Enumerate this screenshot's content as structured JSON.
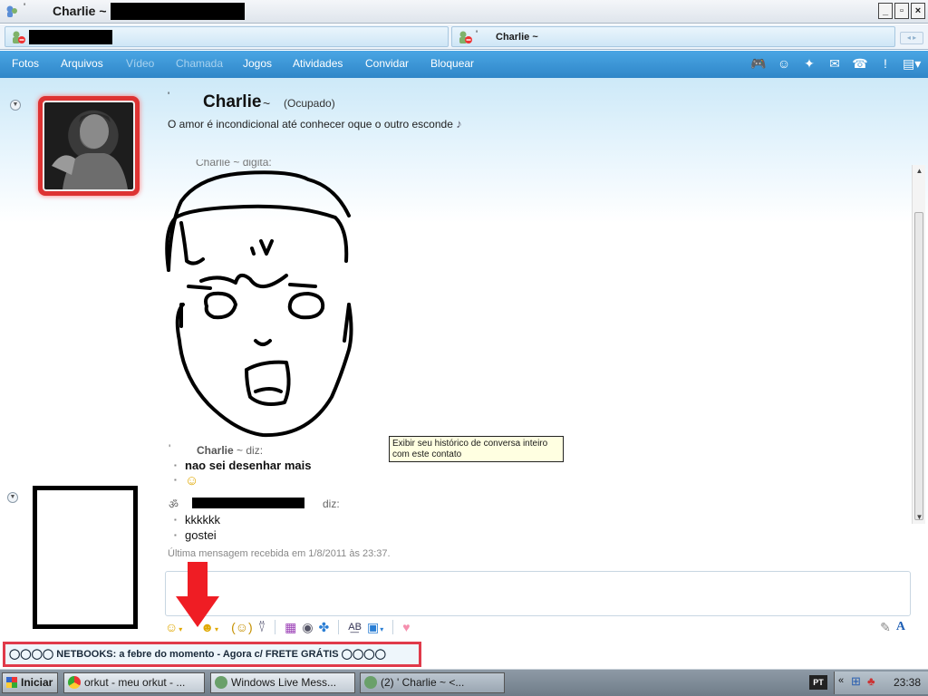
{
  "window": {
    "title": "Charlie ~",
    "tick": "'",
    "controls": {
      "minimize": "_",
      "maximize": "▫",
      "close": "×"
    }
  },
  "tabs": {
    "right_tab_name": "Charlie ~",
    "right_tab_tick": "'"
  },
  "menu": {
    "items": [
      {
        "label": "Fotos",
        "enabled": true
      },
      {
        "label": "Arquivos",
        "enabled": true
      },
      {
        "label": "Vídeo",
        "enabled": false
      },
      {
        "label": "Chamada",
        "enabled": false
      },
      {
        "label": "Jogos",
        "enabled": true
      },
      {
        "label": "Atividades",
        "enabled": true
      },
      {
        "label": "Convidar",
        "enabled": true
      },
      {
        "label": "Bloquear",
        "enabled": true
      }
    ],
    "tool_icons": [
      "games-icon",
      "contact-card-icon",
      "winks-icon",
      "nudge-icon",
      "phone-icon",
      "alert-icon",
      "menu-icon"
    ]
  },
  "contact": {
    "tick": "'",
    "name": "Charlie",
    "tilde": "~",
    "status": "(Ocupado)",
    "personal_message": "O amor é incondicional até conhecer oque o outro esconde"
  },
  "chat": {
    "typing_indicator": "Charlie ~ digita:",
    "messages": [
      {
        "sender_name": "Charlie",
        "sender_suffix": "~ diz:",
        "lines": [
          "nao sei desenhar mais"
        ],
        "emoticon": "thinking-emoticon"
      },
      {
        "sender_suffix": "diz:",
        "lines": [
          "kkkkkk",
          "gostei"
        ]
      }
    ],
    "last_received": "Última mensagem recebida em 1/8/2011 às 23:37."
  },
  "tooltip": {
    "text": "Exibir seu histórico de conversa inteiro com este contato"
  },
  "compose_toolbar": {
    "icons": [
      "emoticon-icon",
      "wink-icon",
      "nudge-icon",
      "voice-clip-icon",
      "backgrounds-icon",
      "sound-icon",
      "games-icon",
      "spellcheck-icon",
      "activities-icon",
      "heart-icon",
      "handwriting-icon",
      "font-icon"
    ]
  },
  "ad": {
    "text": "◯◯◯◯ NETBOOKS: a febre do momento - Agora c/ FRETE GRÁTIS ◯◯◯◯"
  },
  "taskbar": {
    "start": "Iniciar",
    "items": [
      {
        "label": "orkut - meu orkut - ...",
        "active": false
      },
      {
        "label": "Windows Live Mess...",
        "active": false
      },
      {
        "label": "(2) '       Charlie ~ <...",
        "active": true
      }
    ],
    "lang": "PT",
    "clock": "23:38"
  },
  "colors": {
    "menu_bar": "#3a97d9",
    "highlight_red": "#e03a4a",
    "tooltip_bg": "#ffffe1"
  }
}
